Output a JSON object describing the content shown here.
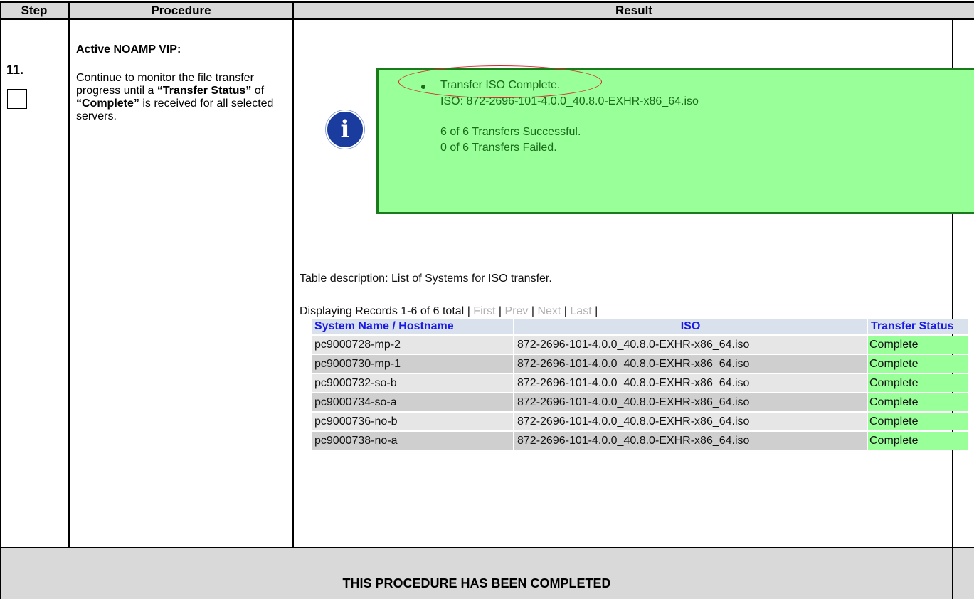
{
  "table_header": {
    "step": "Step",
    "procedure": "Procedure",
    "result": "Result"
  },
  "step_number": "11.",
  "procedure": {
    "heading": "Active NOAMP VIP:",
    "text_1": "Continue to monitor the file transfer progress until a ",
    "transfer_status": "“Transfer Status”",
    "text_2": " of ",
    "complete": "“Complete”",
    "text_3": " is received for all selected servers."
  },
  "status_message": {
    "title": "Transfer ISO Complete.",
    "iso_line": "ISO: 872-2696-101-4.0.0_40.8.0-EXHR-x86_64.iso",
    "successful": "6 of 6 Transfers Successful.",
    "failed": "0 of 6 Transfers Failed."
  },
  "table_description": "Table description: List of Systems for ISO transfer.",
  "records": {
    "displaying": "Displaying Records 1-6 of 6 total",
    "first": "First",
    "prev": "Prev",
    "next": "Next",
    "last": "Last"
  },
  "iso_table": {
    "columns": [
      "System Name / Hostname",
      "ISO",
      "Transfer Status"
    ],
    "rows": [
      [
        "pc9000728-mp-2",
        "872-2696-101-4.0.0_40.8.0-EXHR-x86_64.iso",
        "Complete"
      ],
      [
        "pc9000730-mp-1",
        "872-2696-101-4.0.0_40.8.0-EXHR-x86_64.iso",
        "Complete"
      ],
      [
        "pc9000732-so-b",
        "872-2696-101-4.0.0_40.8.0-EXHR-x86_64.iso",
        "Complete"
      ],
      [
        "pc9000734-so-a",
        "872-2696-101-4.0.0_40.8.0-EXHR-x86_64.iso",
        "Complete"
      ],
      [
        "pc9000736-no-b",
        "872-2696-101-4.0.0_40.8.0-EXHR-x86_64.iso",
        "Complete"
      ],
      [
        "pc9000738-no-a",
        "872-2696-101-4.0.0_40.8.0-EXHR-x86_64.iso",
        "Complete"
      ]
    ]
  },
  "footer": "THIS PROCEDURE HAS BEEN COMPLETED",
  "colors": {
    "header_bg": "#d9d9d9",
    "status_green": "#99ff99",
    "status_border": "#1b7a1b",
    "link_blue": "#1a1ae6",
    "annotation_red": "#d62a2a",
    "info_icon_blue": "#1a3c9e"
  },
  "icons": {
    "status": "info-icon"
  }
}
